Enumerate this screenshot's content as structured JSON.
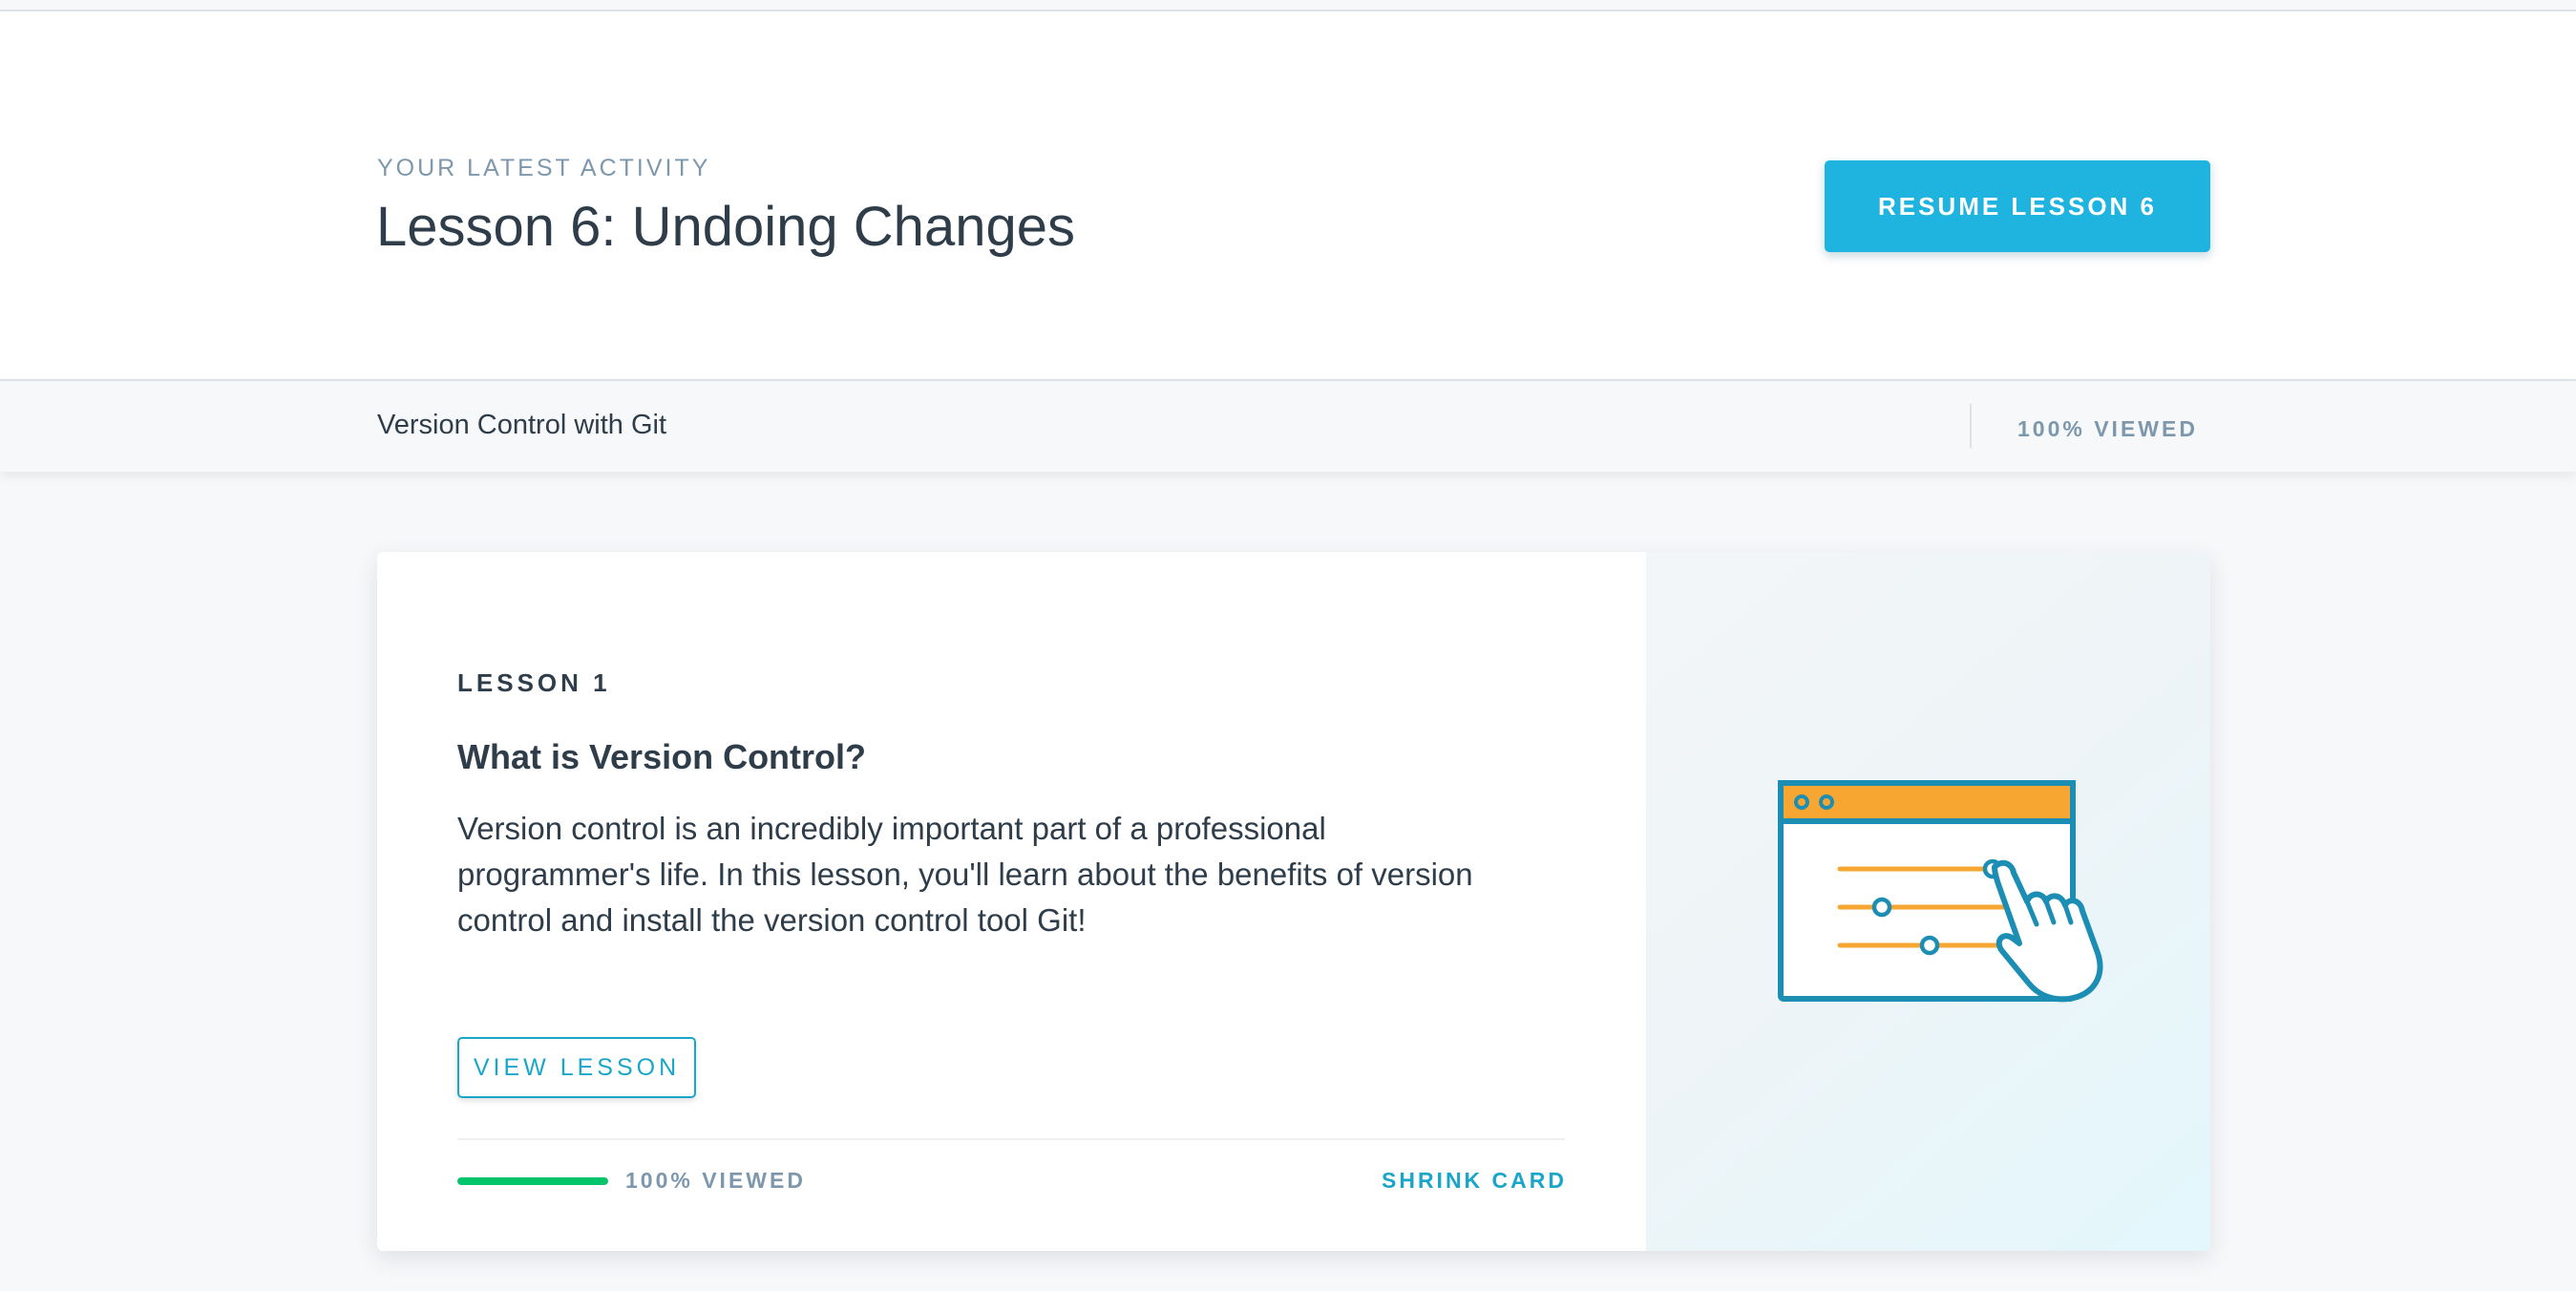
{
  "hero": {
    "eyebrow": "YOUR LATEST ACTIVITY",
    "title": "Lesson 6: Undoing Changes",
    "resume_label": "RESUME LESSON 6"
  },
  "course_bar": {
    "course_name": "Version Control with Git",
    "viewed_label": "100% VIEWED"
  },
  "card": {
    "lesson_number": "LESSON 1",
    "title": "What is Version Control?",
    "description": "Version control is an incredibly important part of a professional programmer's life. In this lesson, you'll learn about the benefits of version control and install the version control tool Git!",
    "view_label": "VIEW LESSON",
    "progress_percent": 100,
    "viewed_label": "100% VIEWED",
    "shrink_label": "SHRINK CARD",
    "illustration_icon": "browser-sliders-hand-icon"
  },
  "colors": {
    "accent": "#1fb3e0",
    "link": "#1aa6c9",
    "progress": "#02c46b",
    "illustration_header": "#f7a632",
    "illustration_stroke": "#1c8db3"
  }
}
